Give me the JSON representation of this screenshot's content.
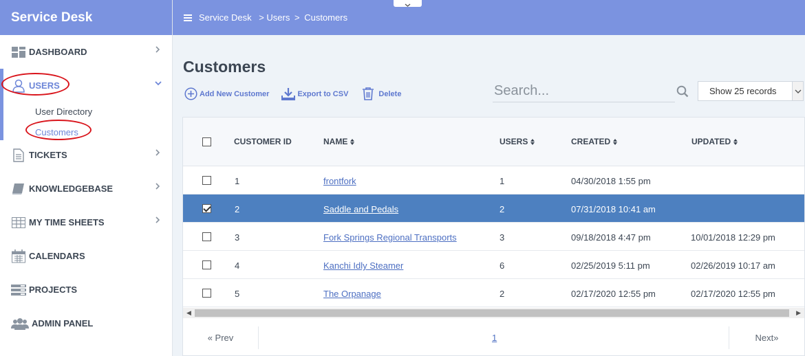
{
  "app": {
    "title": "Service Desk"
  },
  "breadcrumb": {
    "root": "Service Desk",
    "sep1": ">",
    "section": "Users",
    "sep2": ">",
    "page": "Customers"
  },
  "sidebar": {
    "items": [
      {
        "label": "DASHBOARD",
        "icon": "dashboard-icon"
      },
      {
        "label": "USERS",
        "icon": "user-icon",
        "expanded": true
      },
      {
        "label": "TICKETS",
        "icon": "ticket-icon"
      },
      {
        "label": "KNOWLEDGEBASE",
        "icon": "book-icon"
      },
      {
        "label": "MY TIME SHEETS",
        "icon": "timesheet-icon"
      },
      {
        "label": "CALENDARS",
        "icon": "calendar-icon"
      },
      {
        "label": "PROJECTS",
        "icon": "projects-icon"
      },
      {
        "label": "ADMIN PANEL",
        "icon": "admin-icon"
      }
    ],
    "users_sub": [
      {
        "label": "User Directory"
      },
      {
        "label": "Customers",
        "active": true
      }
    ]
  },
  "main": {
    "title": "Customers",
    "toolbar": {
      "add": "Add New Customer",
      "export": "Export to CSV",
      "delete": "Delete"
    },
    "search": {
      "placeholder": "Search..."
    },
    "records": {
      "selected": "Show 25 records"
    }
  },
  "table": {
    "columns": [
      "CUSTOMER ID",
      "NAME",
      "USERS",
      "CREATED",
      "UPDATED"
    ],
    "rows": [
      {
        "id": "1",
        "name": "frontfork",
        "users": "1",
        "created": "04/30/2018 1:55 pm",
        "updated": "",
        "checked": false
      },
      {
        "id": "2",
        "name": "Saddle and Pedals",
        "users": "2",
        "created": "07/31/2018 10:41 am",
        "updated": "",
        "checked": true
      },
      {
        "id": "3",
        "name": "Fork Springs Regional Transports",
        "users": "3",
        "created": "09/18/2018 4:47 pm",
        "updated": "10/01/2018 12:29 pm",
        "checked": false
      },
      {
        "id": "4",
        "name": "Kanchi Idly Steamer",
        "users": "6",
        "created": "02/25/2019 5:11 pm",
        "updated": "02/26/2019 10:17 am",
        "checked": false
      },
      {
        "id": "5",
        "name": "The Orpanage",
        "users": "2",
        "created": "02/17/2020 12:55 pm",
        "updated": "02/17/2020 12:55 pm",
        "checked": false
      }
    ]
  },
  "pager": {
    "prev": "« Prev",
    "page": "1",
    "next": "Next»"
  },
  "colors": {
    "accent": "#7b93e0",
    "selected_row": "#4d80c0",
    "link": "#4d6fc2",
    "annotation": "#d9141b"
  }
}
